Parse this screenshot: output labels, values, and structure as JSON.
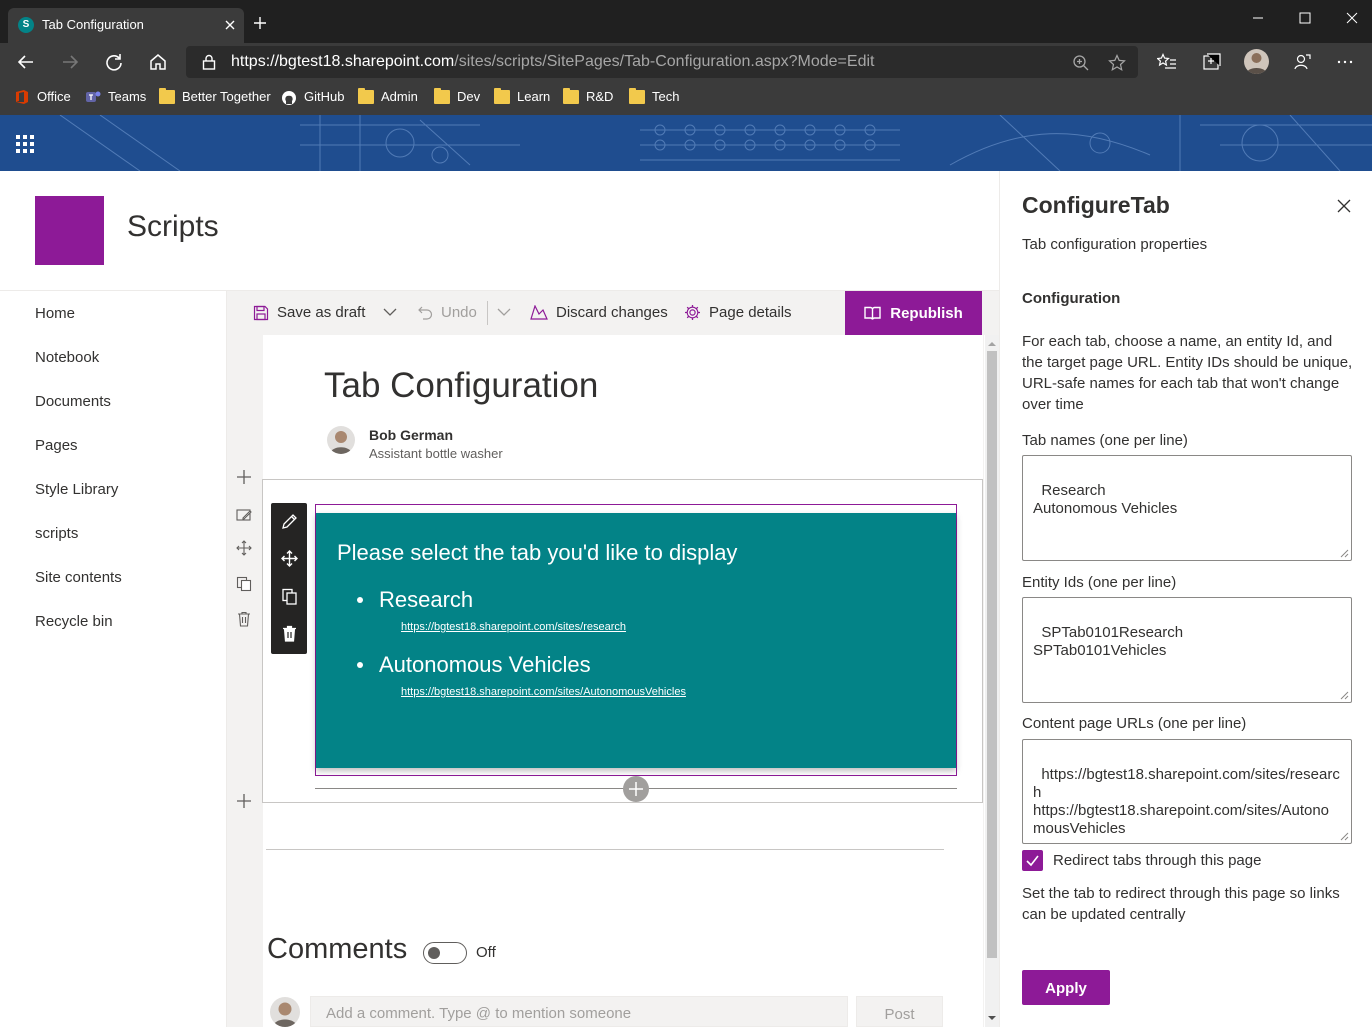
{
  "browser": {
    "tab_title": "Tab Configuration",
    "favicon_letter": "S",
    "url_host": "https://bgtest18.sharepoint.com",
    "url_path": "/sites/scripts/SitePages/Tab-Configuration.aspx?Mode=Edit",
    "bookmarks": [
      "Office",
      "Teams",
      "Better Together",
      "GitHub",
      "Admin",
      "Dev",
      "Learn",
      "R&D",
      "Tech"
    ]
  },
  "site": {
    "title": "Scripts",
    "logo_color": "#8d1a97"
  },
  "nav": {
    "items": [
      "Home",
      "Notebook",
      "Documents",
      "Pages",
      "Style Library",
      "scripts",
      "Site contents",
      "Recycle bin"
    ]
  },
  "commandbar": {
    "save_draft": "Save as draft",
    "undo": "Undo",
    "discard": "Discard changes",
    "page_details": "Page details",
    "republish": "Republish"
  },
  "page": {
    "title": "Tab Configuration",
    "author_name": "Bob German",
    "author_role": "Assistant bottle washer"
  },
  "webpart": {
    "heading": "Please select the tab you'd like to display",
    "accent": "#038387",
    "items": [
      {
        "name": "Research",
        "url": "https://bgtest18.sharepoint.com/sites/research"
      },
      {
        "name": "Autonomous Vehicles",
        "url": "https://bgtest18.sharepoint.com/sites/AutonomousVehicles"
      }
    ]
  },
  "comments": {
    "title": "Comments",
    "toggle_state": "Off",
    "placeholder": "Add a comment. Type @ to mention someone",
    "post": "Post"
  },
  "pane": {
    "title": "ConfigureTab",
    "subtitle": "Tab configuration properties",
    "section": "Configuration",
    "description": "For each tab, choose a name, an entity Id, and the target page URL. Entity IDs should be unique, URL-safe names for each tab that won't change over time",
    "tab_names_label": "Tab names (one per line)",
    "tab_names_value": "Research\nAutonomous Vehicles",
    "entity_ids_label": "Entity Ids (one per line)",
    "entity_ids_value": "SPTab0101Research\nSPTab0101Vehicles",
    "urls_label": "Content page URLs (one per line)",
    "urls_value": "https://bgtest18.sharepoint.com/sites/research\nhttps://bgtest18.sharepoint.com/sites/AutonomousVehicles",
    "redirect_label": "Redirect tabs through this page",
    "redirect_checked": true,
    "redirect_desc": "Set the tab to redirect through this page so links can be updated centrally",
    "apply": "Apply"
  },
  "colors": {
    "theme_primary": "#8d1a97",
    "webpart_background": "#038387"
  }
}
